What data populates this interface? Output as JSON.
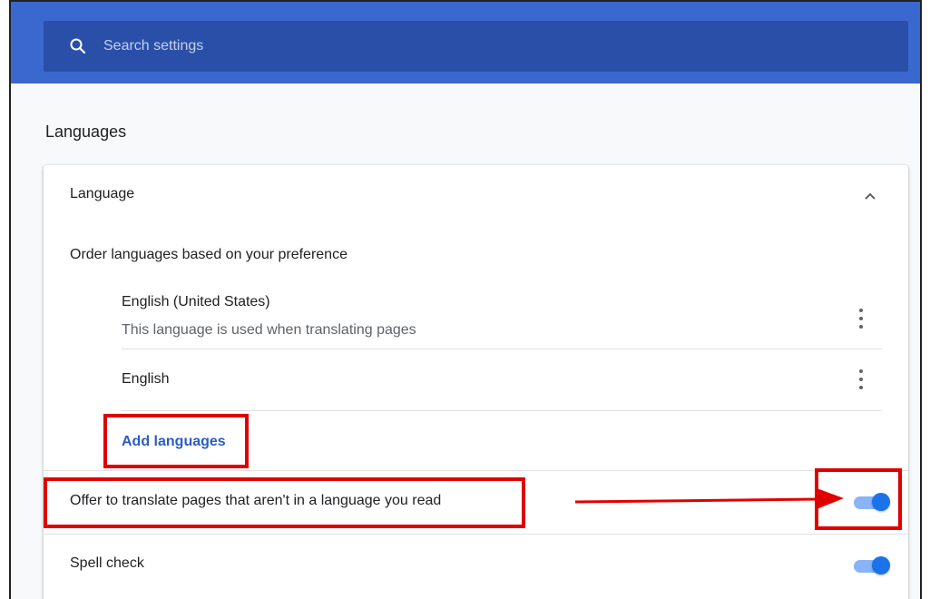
{
  "search": {
    "placeholder": "Search settings",
    "icon": "search-icon"
  },
  "section": {
    "title": "Languages"
  },
  "language_panel": {
    "header": "Language",
    "order_label": "Order languages based on your preference",
    "languages": [
      {
        "name": "English (United States)",
        "description": "This language is used when translating pages"
      },
      {
        "name": "English"
      }
    ],
    "add_languages": "Add languages"
  },
  "settings": {
    "offer_translate": {
      "label": "Offer to translate pages that aren't in a language you read",
      "enabled": true
    },
    "spell_check": {
      "label": "Spell check",
      "enabled": true
    }
  },
  "colors": {
    "header_bg": "#3b68cf",
    "search_bg": "#2a4fa8",
    "accent": "#1a73e8",
    "link": "#2b5cc5",
    "annotation": "#e00000"
  }
}
